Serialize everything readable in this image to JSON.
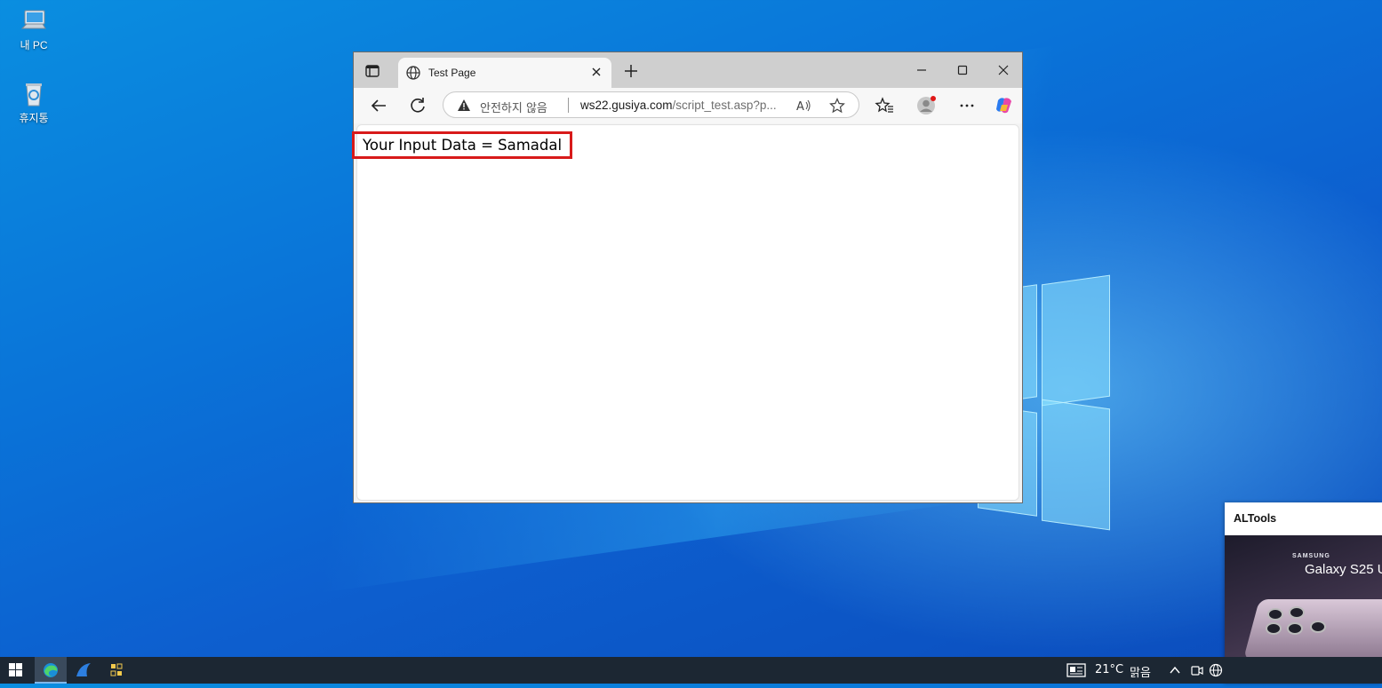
{
  "desktop": {
    "icons": [
      {
        "label": "내 PC",
        "icon": "computer-icon"
      },
      {
        "label": "휴지통",
        "icon": "recycle-bin-icon"
      }
    ]
  },
  "browser": {
    "tab": {
      "title": "Test Page",
      "icon": "globe-icon"
    },
    "address": {
      "security_label": "안전하지 않음",
      "domain": "ws22.gusiya.com",
      "path": "/script_test.asp?p..."
    },
    "page": {
      "text": "Your Input Data = Samadal",
      "highlight_color": "#d81a1a"
    }
  },
  "taskbar": {
    "weather": {
      "temperature": "21°C",
      "condition": "맑음"
    }
  },
  "popup": {
    "title": "ALTools",
    "ad": {
      "brand": "SAMSUNG",
      "model": "Galaxy S25 U"
    }
  }
}
